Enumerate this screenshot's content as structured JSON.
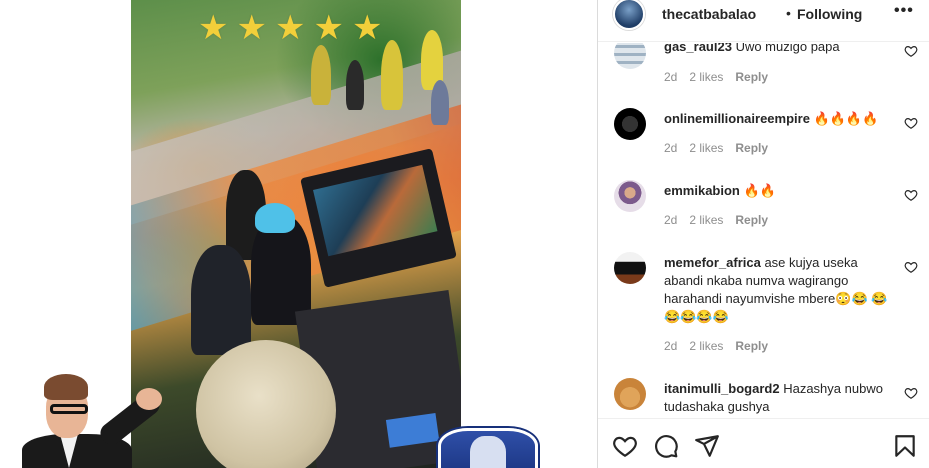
{
  "media": {
    "stars": [
      "★",
      "★",
      "★",
      "★",
      "★"
    ]
  },
  "header": {
    "username": "thecatbabalao",
    "dot": "•",
    "follow_state": "Following",
    "more": "•••"
  },
  "comments": [
    {
      "username": "gas_raul23",
      "text": "Uwo muzigo papa",
      "time": "2d",
      "likes": "2 likes",
      "reply": "Reply",
      "avatar": "striped-avatar"
    },
    {
      "username": "onlinemillionaireempire",
      "text": "🔥🔥🔥🔥",
      "time": "2d",
      "likes": "2 likes",
      "reply": "Reply",
      "avatar": "black-logo-avatar"
    },
    {
      "username": "emmikabion",
      "text": "🔥🔥",
      "time": "2d",
      "likes": "2 likes",
      "reply": "Reply",
      "avatar": "photo-avatar"
    },
    {
      "username": "memefor_africa",
      "text": "ase kujya useka abandi nkaba numva wagirango harahandi nayumvishe mbere😳😂 😂😂😂😂😂",
      "time": "2d",
      "likes": "2 likes",
      "reply": "Reply",
      "avatar": "meme-avatar"
    },
    {
      "username": "itanimulli_bogard2",
      "text": "Hazashya nubwo tudashaka gushya",
      "time": "",
      "likes": "",
      "reply": "",
      "avatar": "orange-avatar"
    }
  ],
  "actions": {
    "like": "heart-icon",
    "comment": "comment-icon",
    "share": "share-icon",
    "save": "bookmark-icon"
  }
}
